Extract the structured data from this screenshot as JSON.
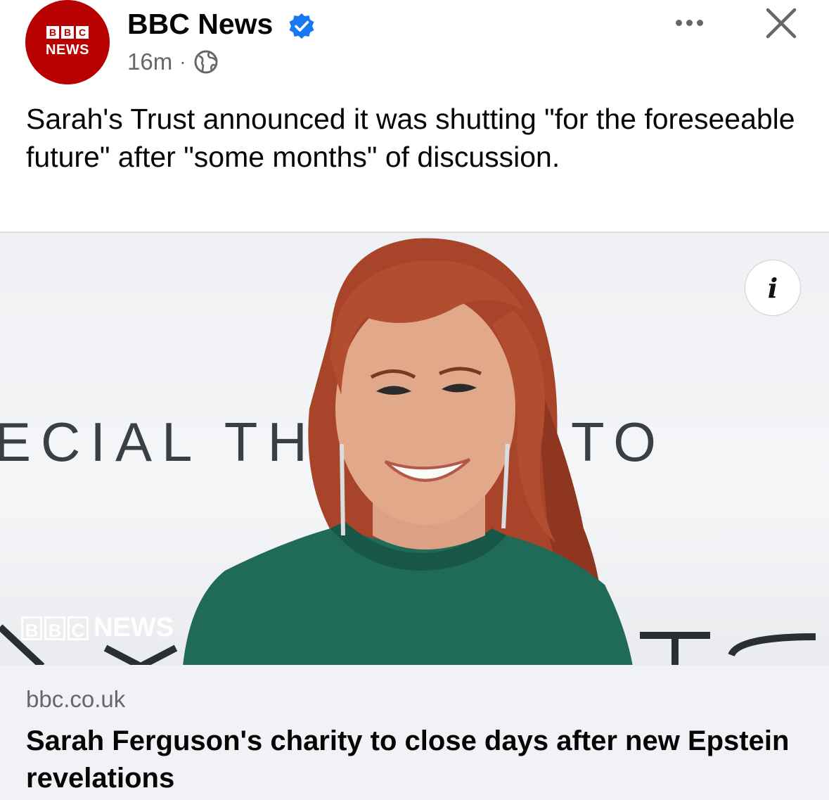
{
  "post": {
    "page_name": "BBC News",
    "avatar": {
      "blocks": [
        "B",
        "B",
        "C"
      ],
      "word": "NEWS",
      "color": "#b80000"
    },
    "verified": true,
    "verified_color": "#1877f2",
    "timestamp": "16m",
    "separator": "·",
    "audience_icon": "globe-icon",
    "more_icon": "more-options-icon",
    "close_icon": "close-icon",
    "caption": "Sarah's Trust announced it was shutting \"for the foreseeable future\" after \"some months\" of discussion."
  },
  "image": {
    "backdrop_text_left": "ECIAL TH",
    "backdrop_text_right": "TO",
    "watermark_blocks": [
      "B",
      "B",
      "C"
    ],
    "watermark_word": "NEWS",
    "info_label": "i"
  },
  "link": {
    "domain": "bbc.co.uk",
    "headline": "Sarah Ferguson's charity to close days after new Epstein revelations"
  }
}
